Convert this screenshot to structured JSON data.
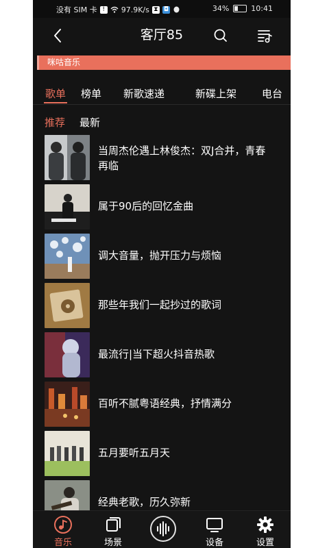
{
  "status_bar": {
    "sim": "没有 SIM 卡",
    "speed": "97.9K/s",
    "battery": "34%",
    "time": "10:41"
  },
  "header": {
    "title": "客厅85",
    "back_icon": "chevron-left-icon",
    "search_icon": "search-icon",
    "playlist_icon": "playlist-icon"
  },
  "source": {
    "label": "咪咕音乐",
    "color": "#e9705c"
  },
  "tabs": [
    {
      "label": "歌单",
      "active": true
    },
    {
      "label": "榜单",
      "active": false
    },
    {
      "label": "新歌速递",
      "active": false
    },
    {
      "label": "新碟上架",
      "active": false
    },
    {
      "label": "电台",
      "active": false
    }
  ],
  "subtabs": [
    {
      "label": "推荐",
      "active": true
    },
    {
      "label": "最新",
      "active": false
    }
  ],
  "playlists": [
    {
      "line1": "当周杰伦遇上林俊杰：双J合并，青春",
      "line2": "再临"
    },
    {
      "line1": "属于90后的回忆金曲",
      "line2": ""
    },
    {
      "line1": "调大音量，抛开压力与烦恼",
      "line2": ""
    },
    {
      "line1": "那些年我们一起抄过的歌词",
      "line2": ""
    },
    {
      "line1": "最流行|当下超火抖音热歌",
      "line2": ""
    },
    {
      "line1": "百听不腻粤语经典，抒情满分",
      "line2": ""
    },
    {
      "line1": "五月要听五月天",
      "line2": ""
    },
    {
      "line1": "经典老歌，历久弥新",
      "line2": ""
    }
  ],
  "bottom_nav": [
    {
      "label": "音乐",
      "icon": "music-note-icon",
      "active": true
    },
    {
      "label": "场景",
      "icon": "scene-icon",
      "active": false
    },
    {
      "label": "设备",
      "icon": "tv-icon",
      "active": false
    },
    {
      "label": "设置",
      "icon": "gear-icon",
      "active": false
    }
  ],
  "center_button_icon": "sound-wave-icon",
  "accent_color": "#e9705c",
  "background_color": "#141414"
}
